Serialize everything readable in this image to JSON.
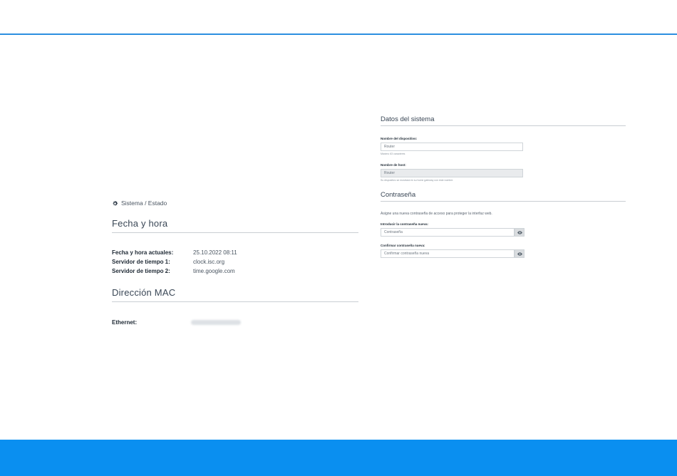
{
  "breadcrumb": {
    "icon": "gear-icon",
    "text": "Sistema / Estado"
  },
  "datetime": {
    "title": "Fecha y hora",
    "rows": [
      {
        "label": "Fecha y hora actuales:",
        "value": "25.10.2022 08:11"
      },
      {
        "label": "Servidor de tiempo 1:",
        "value": "clock.isc.org"
      },
      {
        "label": "Servidor de tiempo 2:",
        "value": "time.google.com"
      }
    ]
  },
  "mac": {
    "title": "Dirección MAC",
    "ethernet_label": "Ethernet:"
  },
  "system": {
    "title": "Datos del sistema",
    "device_name_label": "Nombre del dispositivo:",
    "device_name_value": "Router",
    "device_name_hint": "Máximo 63 caracteres",
    "hostname_label": "Nombre de host:",
    "hostname_value": "Router",
    "hostname_hint": "Su dispositivo se mostrará en su home gateway con este nombre."
  },
  "password": {
    "title": "Contraseña",
    "description": "Asigne una nueva contraseña de acceso para proteger la interfaz web.",
    "new_label": "Introducir la contraseña nueva:",
    "new_placeholder": "Contraseña",
    "confirm_label": "Confirmar contraseña nueva:",
    "confirm_placeholder": "Confirmar contraseña nueva"
  },
  "colors": {
    "accent": "#0a8ff0",
    "rule": "#2c8fe0"
  }
}
